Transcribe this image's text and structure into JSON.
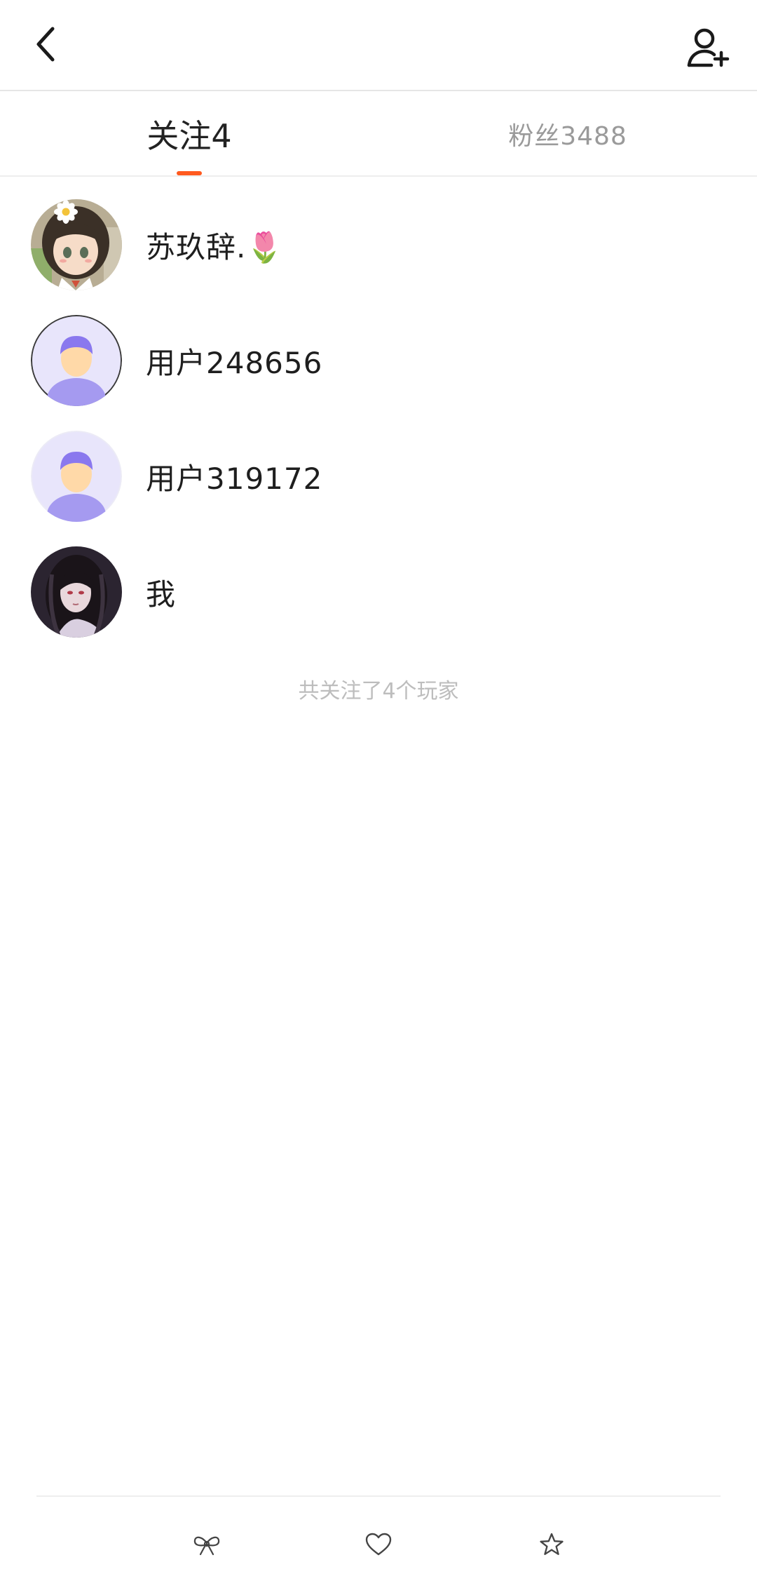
{
  "header": {
    "back_icon": "chevron-left-icon",
    "add_user_icon": "user-plus-icon"
  },
  "tabs": [
    {
      "label": "关注4",
      "active": true
    },
    {
      "label": "粉丝3488",
      "active": false
    }
  ],
  "accent_color": "#ff5a1f",
  "following": [
    {
      "name": "苏玖辞.🌷",
      "avatar": "anime-girl-flower-avatar"
    },
    {
      "name": "用户248656",
      "avatar": "default-user-avatar"
    },
    {
      "name": "用户319172",
      "avatar": "default-user-avatar"
    },
    {
      "name": "我",
      "avatar": "dark-haired-girl-avatar"
    }
  ],
  "footer_note": "共关注了4个玩家",
  "bottom_bar": {
    "icons": [
      "bow-icon",
      "heart-icon",
      "star-icon"
    ]
  }
}
